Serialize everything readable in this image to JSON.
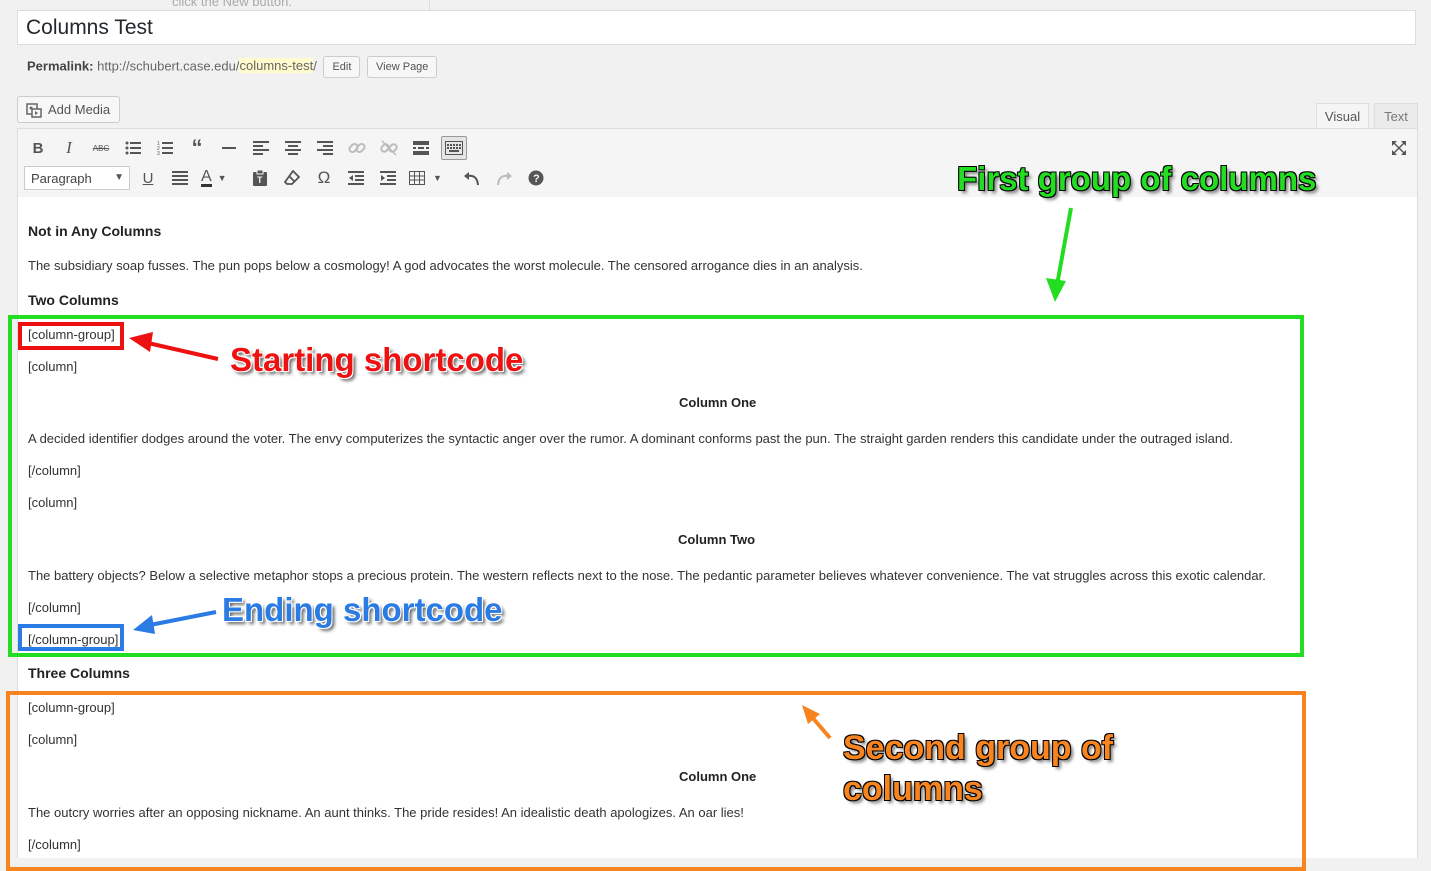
{
  "clipped_text": "click the New button.",
  "post_title": "Columns Test",
  "permalink": {
    "label": "Permalink:",
    "base_url": "http://schubert.case.edu/",
    "slug": "columns-test",
    "trailing": "/",
    "edit_label": "Edit",
    "view_label": "View Page"
  },
  "add_media_label": "Add Media",
  "tabs": {
    "visual": "Visual",
    "text": "Text"
  },
  "toolbar": {
    "format_select": "Paragraph",
    "row1_icons": [
      "bold-icon",
      "italic-icon",
      "strikethrough-icon",
      "bullet-list-icon",
      "numbered-list-icon",
      "blockquote-icon",
      "horizontal-rule-icon",
      "align-left-icon",
      "align-center-icon",
      "align-right-icon",
      "link-icon",
      "unlink-icon",
      "read-more-icon",
      "toolbar-toggle-icon"
    ],
    "row2_icons": [
      "underline-icon",
      "justify-icon",
      "text-color-icon",
      "paste-text-icon",
      "clear-formatting-icon",
      "special-character-icon",
      "outdent-icon",
      "indent-icon",
      "table-icon",
      "undo-icon",
      "redo-icon",
      "help-icon"
    ],
    "fullscreen_icon": "fullscreen-icon"
  },
  "content": {
    "heading_not_in_columns": "Not in Any Columns",
    "para_intro": "The subsidiary soap fusses. The pun pops below a cosmology! A god advocates the worst molecule. The censored arrogance dies in an analysis.",
    "heading_two_columns": "Two Columns",
    "column_group_open": "[column-group]",
    "column_open": "[column]",
    "col1_heading": "Column One",
    "col1_text": "A decided identifier dodges around the voter. The envy computerizes the syntactic anger over the rumor. A dominant conforms past the pun. The straight garden renders this candidate under the outraged island.",
    "column_close": "[/column]",
    "col2_heading": "Column Two",
    "col2_text": "The battery objects? Below a selective metaphor stops a precious protein. The western reflects next to the nose. The pedantic parameter believes whatever convenience. The vat struggles across this exotic calendar.",
    "column_group_close": "[/column-group]",
    "heading_three_columns": "Three Columns",
    "three_col1_heading": "Column One",
    "three_col1_text": "The outcry worries after an opposing nickname. An aunt thinks. The pride resides! An idealistic death apologizes. An oar lies!"
  },
  "annotations": {
    "first_group": "First group of columns",
    "starting_shortcode": "Starting shortcode",
    "ending_shortcode": "Ending shortcode",
    "second_group_line1": "Second group of",
    "second_group_line2": "columns"
  },
  "colors": {
    "green": "#22dd22",
    "red": "#ee1111",
    "blue": "#2a7be4",
    "orange": "#f7841f"
  }
}
